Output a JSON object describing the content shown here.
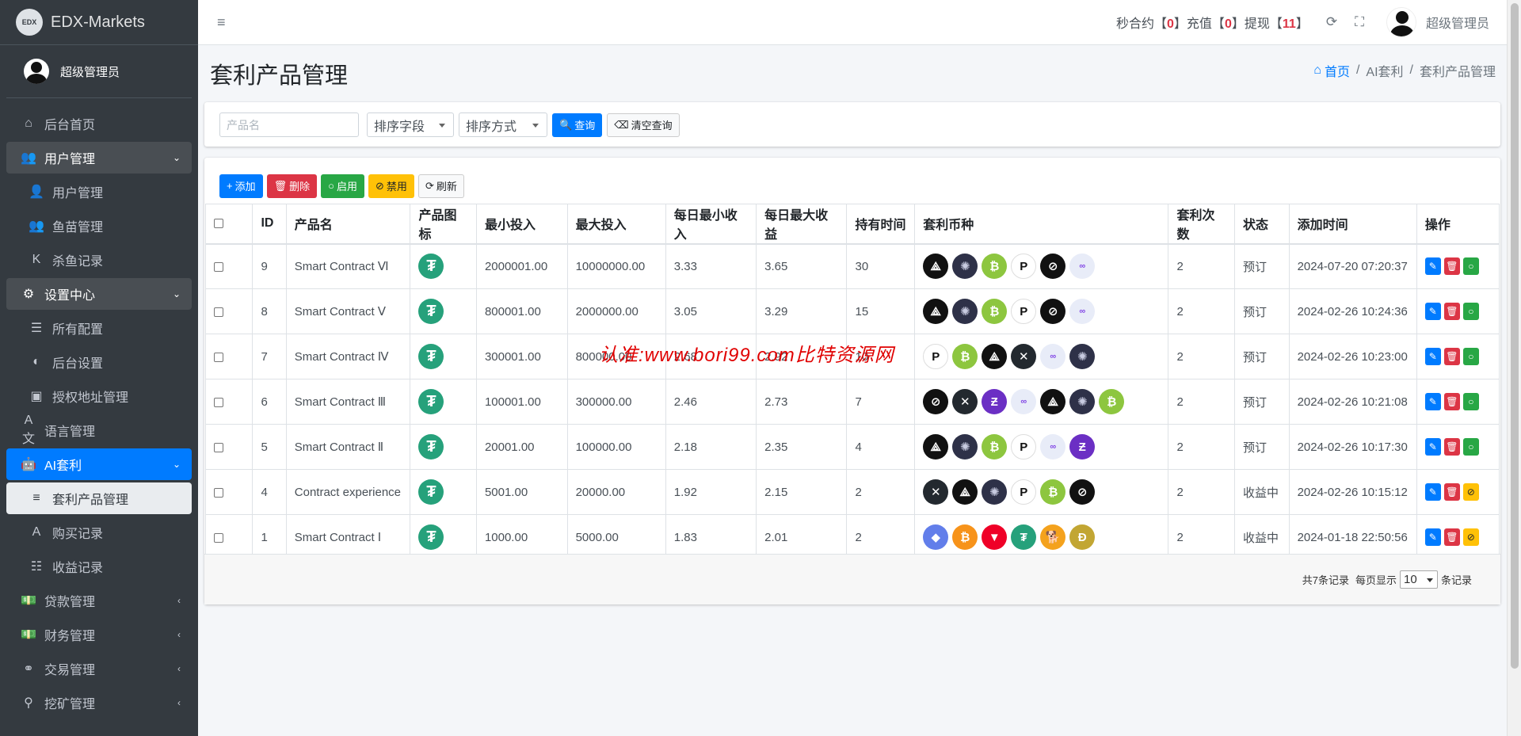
{
  "brand": {
    "logo": "EDX",
    "name": "EDX-Markets"
  },
  "sidebar": {
    "user": "超级管理员",
    "items": [
      {
        "label": "后台首页",
        "icon": "home-icon",
        "glyph": "⌂",
        "name": "sidebar-item-home",
        "type": "top"
      },
      {
        "label": "用户管理",
        "icon": "users-icon",
        "glyph": "👥",
        "name": "sidebar-item-user-mgmt",
        "type": "open",
        "chev": "⌄"
      },
      {
        "label": "用户管理",
        "icon": "user-icon",
        "glyph": "👤",
        "name": "sidebar-subitem-users",
        "type": "sub"
      },
      {
        "label": "鱼苗管理",
        "icon": "users-icon",
        "glyph": "👥",
        "name": "sidebar-subitem-fish",
        "type": "sub"
      },
      {
        "label": "杀鱼记录",
        "icon": "k-icon",
        "glyph": "K",
        "name": "sidebar-subitem-kill-records",
        "type": "sub"
      },
      {
        "label": "设置中心",
        "icon": "cogs-icon",
        "glyph": "⚙",
        "name": "sidebar-item-settings",
        "type": "open",
        "chev": "⌄"
      },
      {
        "label": "所有配置",
        "icon": "list-icon",
        "glyph": "☰",
        "name": "sidebar-subitem-all-config",
        "type": "sub"
      },
      {
        "label": "后台设置",
        "icon": "adjust-icon",
        "glyph": "◐",
        "name": "sidebar-subitem-admin-settings",
        "type": "sub"
      },
      {
        "label": "授权地址管理",
        "icon": "address-book-icon",
        "glyph": "▣",
        "name": "sidebar-subitem-auth-address",
        "type": "sub"
      },
      {
        "label": "语言管理",
        "icon": "language-icon",
        "glyph": "A文",
        "name": "sidebar-item-language",
        "type": "top"
      },
      {
        "label": "AI套利",
        "icon": "android-icon",
        "glyph": "🤖",
        "name": "sidebar-item-ai-arbitrage",
        "type": "active",
        "chev": "⌄"
      },
      {
        "label": "套利产品管理",
        "icon": "bars-icon",
        "glyph": "≡",
        "name": "sidebar-subitem-arbitrage-products",
        "type": "selected"
      },
      {
        "label": "购买记录",
        "icon": "font-icon",
        "glyph": "A",
        "name": "sidebar-subitem-purchase-records",
        "type": "sub"
      },
      {
        "label": "收益记录",
        "icon": "tasks-icon",
        "glyph": "☷",
        "name": "sidebar-subitem-income-records",
        "type": "sub"
      },
      {
        "label": "贷款管理",
        "icon": "money-icon",
        "glyph": "💵",
        "name": "sidebar-item-loans",
        "type": "top",
        "chev": "‹"
      },
      {
        "label": "财务管理",
        "icon": "money-icon",
        "glyph": "💵",
        "name": "sidebar-item-finance",
        "type": "top",
        "chev": "‹"
      },
      {
        "label": "交易管理",
        "icon": "network-icon",
        "glyph": "⚭",
        "name": "sidebar-item-trade",
        "type": "top",
        "chev": "‹"
      },
      {
        "label": "挖矿管理",
        "icon": "search-icon",
        "glyph": "⚲",
        "name": "sidebar-item-mining",
        "type": "top",
        "chev": "‹"
      }
    ]
  },
  "header": {
    "menu_glyph": "≡",
    "stats": [
      {
        "label": "秒合约",
        "open": "【",
        "value": "0",
        "close": "】"
      },
      {
        "label": "充值",
        "open": "【",
        "value": "0",
        "close": "】"
      },
      {
        "label": "提现",
        "open": "【",
        "value": "11",
        "close": "】"
      }
    ],
    "refresh_glyph": "⟳",
    "fullscreen_glyph": "⛶",
    "user": "超级管理员"
  },
  "page": {
    "title": "套利产品管理",
    "breadcrumb": {
      "home_glyph": "⌂",
      "home": "首页",
      "sep": "/",
      "level2": "AI套利",
      "level3": "套利产品管理"
    }
  },
  "filter": {
    "name_placeholder": "产品名",
    "sort_field": "排序字段",
    "sort_order": "排序方式",
    "query_glyph": "🔍",
    "query": "查询",
    "clear_glyph": "⌫",
    "clear": "清空查询"
  },
  "toolbar": {
    "add_glyph": "+",
    "add": "添加",
    "delete_glyph": "🗑",
    "delete": "删除",
    "enable_glyph": "○",
    "enable": "启用",
    "disable_glyph": "⊘",
    "disable": "禁用",
    "refresh_glyph": "⟳",
    "refresh": "刷新"
  },
  "table": {
    "columns": [
      "ID",
      "产品名",
      "产品图标",
      "最小投入",
      "最大投入",
      "每日最小收入",
      "每日最大收益",
      "持有时间",
      "套利币种",
      "套利次数",
      "状态",
      "添加时间",
      "操作"
    ],
    "icon_glyph": "₮",
    "rows": [
      {
        "id": "9",
        "name": "Smart Contract Ⅵ",
        "min": "2000001.00",
        "max": "10000000.00",
        "dmin": "3.33",
        "dmax": "3.65",
        "hold": "30",
        "coins": [
          "eos",
          "atom",
          "btc",
          "dot",
          "xlm",
          "poly"
        ],
        "times": "2",
        "status": "预订",
        "time": "2024-07-20 07:20:37",
        "toggle": "on"
      },
      {
        "id": "8",
        "name": "Smart Contract Ⅴ",
        "min": "800001.00",
        "max": "2000000.00",
        "dmin": "3.05",
        "dmax": "3.29",
        "hold": "15",
        "coins": [
          "eos",
          "atom",
          "btc",
          "dot",
          "xlm",
          "poly"
        ],
        "times": "2",
        "status": "预订",
        "time": "2024-02-26 10:24:36",
        "toggle": "on"
      },
      {
        "id": "7",
        "name": "Smart Contract Ⅳ",
        "min": "300001.00",
        "max": "800000.00",
        "dmin": "2.68",
        "dmax": "2.92",
        "hold": "10",
        "coins": [
          "dot",
          "btc",
          "eos",
          "xrp",
          "poly",
          "atom"
        ],
        "times": "2",
        "status": "预订",
        "time": "2024-02-26 10:23:00",
        "toggle": "on"
      },
      {
        "id": "6",
        "name": "Smart Contract Ⅲ",
        "min": "100001.00",
        "max": "300000.00",
        "dmin": "2.46",
        "dmax": "2.73",
        "hold": "7",
        "coins": [
          "xlm",
          "xrp",
          "zec",
          "poly",
          "eos",
          "atom",
          "btc"
        ],
        "times": "2",
        "status": "预订",
        "time": "2024-02-26 10:21:08",
        "toggle": "on"
      },
      {
        "id": "5",
        "name": "Smart Contract Ⅱ",
        "min": "20001.00",
        "max": "100000.00",
        "dmin": "2.18",
        "dmax": "2.35",
        "hold": "4",
        "coins": [
          "eos",
          "atom",
          "btc",
          "dot",
          "poly",
          "zec"
        ],
        "times": "2",
        "status": "预订",
        "time": "2024-02-26 10:17:30",
        "toggle": "on"
      },
      {
        "id": "4",
        "name": "Contract experience",
        "min": "5001.00",
        "max": "20000.00",
        "dmin": "1.92",
        "dmax": "2.15",
        "hold": "2",
        "coins": [
          "xrp",
          "eos",
          "atom",
          "dot",
          "btc",
          "xlm"
        ],
        "times": "2",
        "status": "收益中",
        "time": "2024-02-26 10:15:12",
        "toggle": "off"
      },
      {
        "id": "1",
        "name": "Smart Contract Ⅰ",
        "min": "1000.00",
        "max": "5000.00",
        "dmin": "1.83",
        "dmax": "2.01",
        "hold": "2",
        "coins": [
          "eth",
          "btco",
          "trx",
          "usdt",
          "shib",
          "doge"
        ],
        "times": "2",
        "status": "收益中",
        "time": "2024-01-18 22:50:56",
        "toggle": "off"
      }
    ]
  },
  "coin_glyphs": {
    "eos": "⟁",
    "atom": "✺",
    "btc": "₿",
    "dot": "P",
    "xlm": "⊘",
    "poly": "∞",
    "xrp": "✕",
    "zec": "Ƶ",
    "eth": "◆",
    "btco": "₿",
    "trx": "▼",
    "usdt": "₮",
    "shib": "🐕",
    "doge": "Ð"
  },
  "action_glyphs": {
    "edit": "✎",
    "del": "🗑",
    "on": "○",
    "off": "⊘"
  },
  "pager": {
    "total": "共7条记录",
    "per_page_label": "每页显示",
    "per_page": "10",
    "unit": "条记录"
  },
  "watermark": "认准:www.bori99.com比特资源网",
  "colors": {
    "primary": "#007bff",
    "danger": "#dc3545",
    "success": "#28a745",
    "warning": "#ffc107",
    "sidebar": "#343a40"
  }
}
